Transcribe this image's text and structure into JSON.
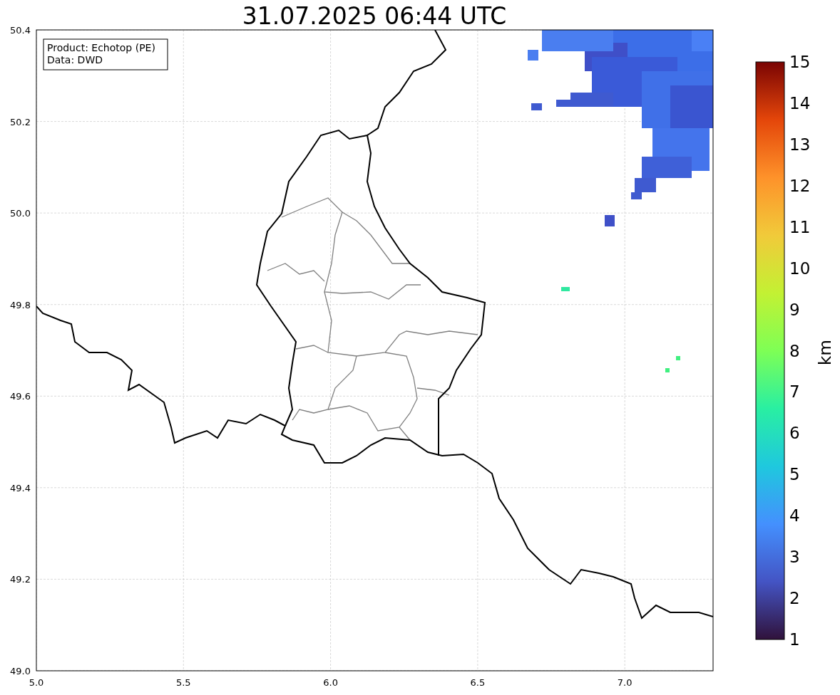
{
  "title": "31.07.2025 06:44 UTC",
  "info_box": [
    "Product: Echotop (PE)",
    "Data: DWD"
  ],
  "map": {
    "xticks": [
      "5.0",
      "5.5",
      "6.0",
      "6.5",
      "7.0"
    ],
    "yticks": [
      "50.4",
      "50.2",
      "50.0",
      "49.8",
      "49.6",
      "49.4",
      "49.2",
      "49.0"
    ]
  },
  "colorbar": {
    "label": "km",
    "ticks": [
      "15",
      "14",
      "13",
      "12",
      "11",
      "10",
      "9",
      "8",
      "7",
      "6",
      "5",
      "4",
      "3",
      "2",
      "1"
    ]
  }
}
